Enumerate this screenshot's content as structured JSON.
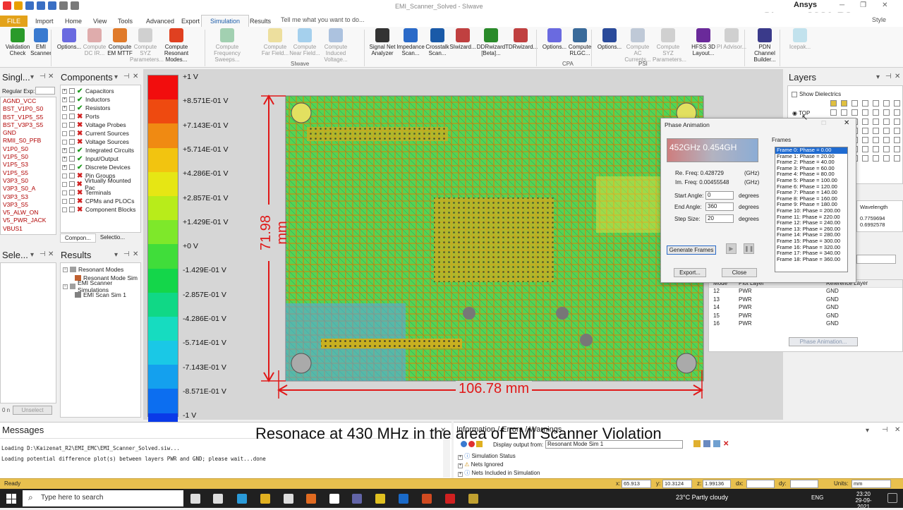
{
  "window": {
    "title": "EMI_Scanner_Solved - SIwave",
    "brand_company": "Ansys",
    "brand_product": "SIwave 2021 R2",
    "style_label": "Style"
  },
  "ribbon_tabs": [
    "FILE",
    "Import",
    "Home",
    "View",
    "Tools",
    "Advanced",
    "Export",
    "Simulation",
    "Results"
  ],
  "active_tab": "Simulation",
  "tell_me": "Tell me what you want to do...",
  "ribbon": {
    "buttons": [
      {
        "label": "Validation Check",
        "dim": false
      },
      {
        "label": "EMI Scanner",
        "dim": false
      },
      {
        "label": "Options...",
        "dim": false
      },
      {
        "label": "Compute DC IR...",
        "dim": true
      },
      {
        "label": "Compute EM MTTF",
        "dim": false
      },
      {
        "label": "Compute SYZ Parameters...",
        "dim": true
      },
      {
        "label": "Compute Resonant Modes...",
        "dim": false
      },
      {
        "label": "Compute Frequency Sweeps...",
        "dim": true
      },
      {
        "label": "Compute Far Field...",
        "dim": true
      },
      {
        "label": "Compute Near Field...",
        "dim": true
      },
      {
        "label": "Compute Induced Voltage...",
        "dim": true
      },
      {
        "label": "Signal Net Analyzer",
        "dim": false
      },
      {
        "label": "Impedance Scan...",
        "dim": false
      },
      {
        "label": "Crosstalk Scan...",
        "dim": false
      },
      {
        "label": "SIwizard...",
        "dim": false
      },
      {
        "label": "DDRwizard [Beta]...",
        "dim": false
      },
      {
        "label": "TDRwizard...",
        "dim": false
      },
      {
        "label": "Options...",
        "dim": false
      },
      {
        "label": "Compute RLGC...",
        "dim": false
      },
      {
        "label": "Options...",
        "dim": false
      },
      {
        "label": "Compute AC Currents...",
        "dim": true
      },
      {
        "label": "Compute SYZ Parameters...",
        "dim": true
      },
      {
        "label": "HFSS 3D Layout...",
        "dim": false
      },
      {
        "label": "PI Advisor...",
        "dim": true
      },
      {
        "label": "PDN Channel Builder...",
        "dim": false
      },
      {
        "label": "Icepak...",
        "dim": true
      }
    ],
    "groups": [
      "SIwave",
      "CPA",
      "PSI"
    ]
  },
  "single_panel": {
    "title": "Singl...",
    "regex_label": "Regular Exp:",
    "nets": [
      "AGND_VCC",
      "BST_V1P0_S0",
      "BST_V1P5_S5",
      "BST_V3P3_S5",
      "GND",
      "RMII_S0_PFB",
      "V1P0_S0",
      "V1P5_S0",
      "V1P5_S3",
      "V1P5_S5",
      "V3P3_S0",
      "V3P3_S0_A",
      "V3P3_S3",
      "V3P3_S5",
      "V5_ALW_ON",
      "V5_PWR_JACK",
      "VBUS1"
    ]
  },
  "components_panel": {
    "title": "Components",
    "items": [
      {
        "label": "Capacitors",
        "mark": "tick"
      },
      {
        "label": "Inductors",
        "mark": "tick"
      },
      {
        "label": "Resistors",
        "mark": "tick"
      },
      {
        "label": "Ports",
        "mark": "x"
      },
      {
        "label": "Voltage Probes",
        "mark": "x"
      },
      {
        "label": "Current Sources",
        "mark": "x"
      },
      {
        "label": "Voltage Sources",
        "mark": "x"
      },
      {
        "label": "Integrated Circuits",
        "mark": "tick"
      },
      {
        "label": "Input/Output",
        "mark": "tick"
      },
      {
        "label": "Discrete Devices",
        "mark": "tick"
      },
      {
        "label": "Pin Groups",
        "mark": "x"
      },
      {
        "label": "Virtually Mounted Pac",
        "mark": "x"
      },
      {
        "label": "Terminals",
        "mark": "x"
      },
      {
        "label": "CPMs and PLOCs",
        "mark": "x"
      },
      {
        "label": "Component Blocks",
        "mark": "x"
      }
    ],
    "tab1": "Compon...",
    "tab2": "Selectio..."
  },
  "select_panel": {
    "title": "Sele...",
    "unselect": "Unselect",
    "count": "0 n"
  },
  "results_panel": {
    "title": "Results",
    "items": [
      "Resonant Modes",
      "Resonant Mode Sim",
      "EMI Scanner Simulations",
      "EMI Scan Sim 1"
    ]
  },
  "colorbar": {
    "colors": [
      "#f20d0d",
      "#ee4a10",
      "#f08a12",
      "#f2c410",
      "#e6e614",
      "#b8ec1a",
      "#7ee82a",
      "#40dd3a",
      "#14d64a",
      "#10d886",
      "#16dcc0",
      "#1ac8e6",
      "#14a0ee",
      "#0c6ef0",
      "#0a3ae8"
    ],
    "labels": [
      "+1 V",
      "+8.571E-01 V",
      "+7.143E-01 V",
      "+5.714E-01 V",
      "+4.286E-01 V",
      "+2.857E-01 V",
      "+1.429E-01 V",
      "+0 V",
      "-1.429E-01 V",
      "-2.857E-01 V",
      "-4.286E-01 V",
      "-5.714E-01 V",
      "-7.143E-01 V",
      "-8.571E-01 V",
      "-1 V"
    ]
  },
  "board": {
    "height_dim": "71.98 mm",
    "width_dim": "106.78 mm"
  },
  "phase_dialog": {
    "title": "Phase Animation",
    "preview_text": "452GHz 0.454GH",
    "re_freq_label": "Re. Freq: 0.428729",
    "im_freq_label": "Im. Freq: 0.00455548",
    "freq_unit": "(GHz)",
    "start_angle_label": "Start Angle:",
    "start_angle": "0",
    "end_angle_label": "End Angle:",
    "end_angle": "360",
    "step_size_label": "Step Size:",
    "step_size": "20",
    "unit": "degrees",
    "generate_btn": "Generate Frames",
    "export_btn": "Export...",
    "close_btn": "Close",
    "frames_label": "Frames",
    "frames": [
      "Frame 0: Phase = 0.00",
      "Frame 1: Phase = 20.00",
      "Frame 2: Phase = 40.00",
      "Frame 3: Phase = 60.00",
      "Frame 4: Phase = 80.00",
      "Frame 5: Phase = 100.00",
      "Frame 6: Phase = 120.00",
      "Frame 7: Phase = 140.00",
      "Frame 8: Phase = 160.00",
      "Frame 9: Phase = 180.00",
      "Frame 10: Phase = 200.00",
      "Frame 11: Phase = 220.00",
      "Frame 12: Phase = 240.00",
      "Frame 13: Phase = 260.00",
      "Frame 14: Phase = 280.00",
      "Frame 15: Phase = 300.00",
      "Frame 16: Phase = 320.00",
      "Frame 17: Phase = 340.00",
      "Frame 18: Phase = 360.00"
    ]
  },
  "layers_panel": {
    "title": "Layers",
    "show_dielectrics": "Show Dielectrics",
    "top_label": "TOP",
    "wavelength_header": "Wavelength",
    "wavelength_values": [
      "0.7759694",
      "0.6992578"
    ],
    "table_headers": [
      "Mode",
      "Plot Layer",
      "Reference Layer"
    ],
    "rows": [
      [
        "12",
        "PWR",
        "GND"
      ],
      [
        "13",
        "PWR",
        "GND"
      ],
      [
        "14",
        "PWR",
        "GND"
      ],
      [
        "15",
        "PWR",
        "GND"
      ],
      [
        "16",
        "PWR",
        "GND"
      ]
    ],
    "phase_anim_btn": "Phase Animation..."
  },
  "messages": {
    "title": "Messages",
    "lines": [
      "Loading D:\\Kaizenat_R2\\EMI_EMC\\EMI_Scanner_Solved.siw...",
      "Loading potential difference plot(s) between layers PWR and GND; please wait...done"
    ]
  },
  "info_panel": {
    "title": "Information / Errors / Warnings",
    "display_label": "Display output from:",
    "display_value": "Resonant Mode Sim 1",
    "items": [
      "Simulation Status",
      "Nets Ignored",
      "Nets Included in Simulation"
    ]
  },
  "caption": "Resonace at 430 MHz in the area of EMI Scanner Violation",
  "statusbar": {
    "ready": "Ready",
    "x_label": "x:",
    "x": "65.913",
    "y_label": "y:",
    "y": "10.3124",
    "z_label": "z:",
    "z": "1.99136",
    "dx_label": "dx:",
    "dy_label": "dy:",
    "units_label": "Units:",
    "units": "mm"
  },
  "taskbar": {
    "search": "Type here to search",
    "weather": "23°C  Partly cloudy",
    "lang": "ENG",
    "time": "23:20",
    "date": "29-09-2021"
  }
}
